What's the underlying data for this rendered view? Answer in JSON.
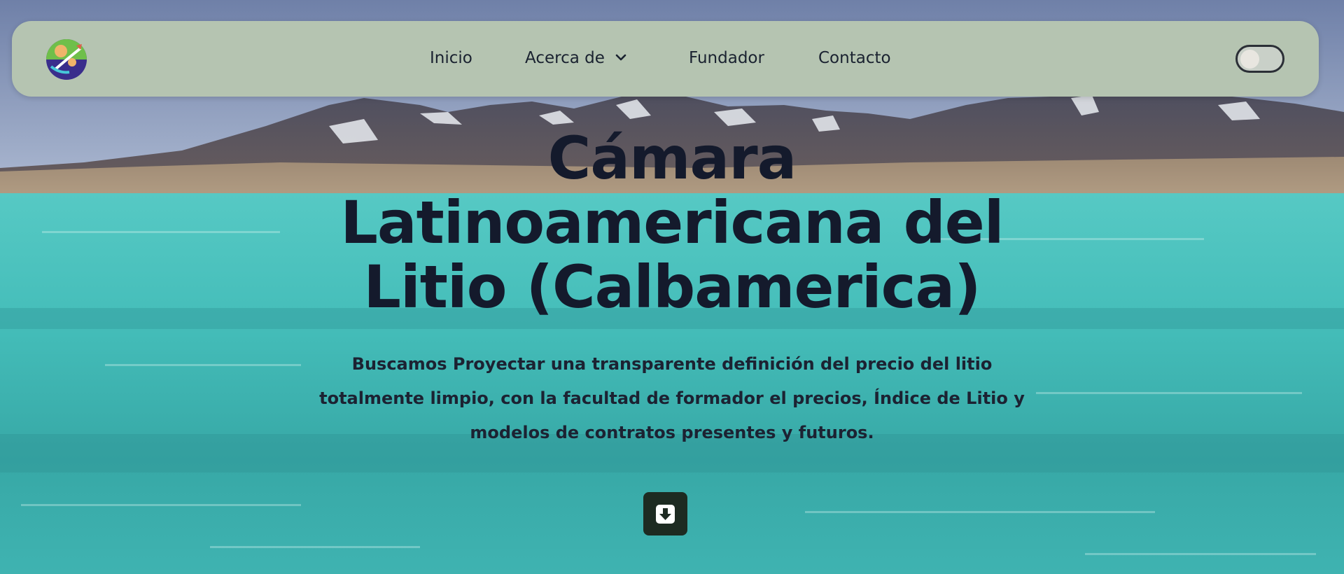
{
  "nav": {
    "items": [
      {
        "label": "Inicio"
      },
      {
        "label": "Acerca de",
        "icon": "chevron-down-icon"
      },
      {
        "label": "Fundador"
      },
      {
        "label": "Contacto"
      }
    ],
    "logo_icon": "lithium-logo-icon",
    "theme_toggle": {
      "state": "off",
      "icon": "toggle-switch-icon"
    }
  },
  "hero": {
    "title": "Cámara Latinoamericana del Litio (Calbamerica)",
    "subtitle": "Buscamos Proyectar una transparente definición del precio del litio totalmente limpio, con la facultad de formador el precios, Índice de Litio y modelos de contratos presentes y futuros.",
    "scroll_button_icon": "download-arrow-icon"
  },
  "colors": {
    "navbar_bg": "#b5c4b1",
    "text_dark": "#141a2c",
    "button_dark": "#1d2b22",
    "lagoon": "#3cb5b5"
  }
}
